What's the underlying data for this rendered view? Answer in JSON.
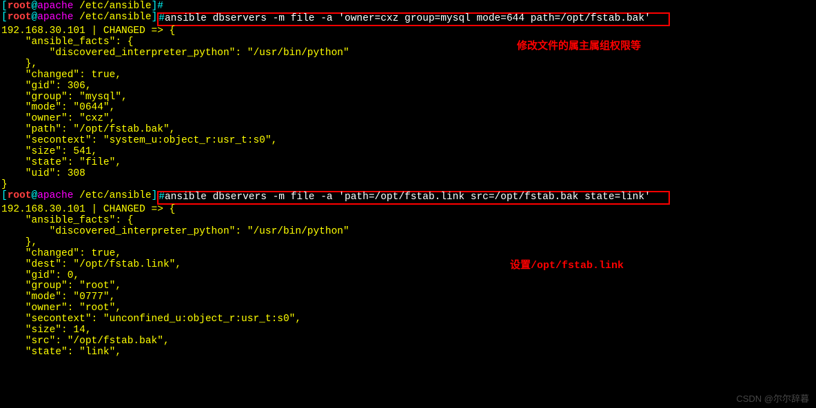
{
  "prompt": {
    "user": "root",
    "host": "apache",
    "path": "/etc/ansible"
  },
  "cmd1": {
    "text": "ansible dbservers -m file -a 'owner=cxz group=mysql mode=644 path=/opt/fstab.bak'"
  },
  "note1": "修改文件的属主属组权限等",
  "out1": {
    "header": "192.168.30.101 | CHANGED => {",
    "facts_open": "    \"ansible_facts\": {",
    "disc": "        \"discovered_interpreter_python\": \"/usr/bin/python\"",
    "facts_close": "    },",
    "changed": "    \"changed\": true,",
    "gid": "    \"gid\": 306,",
    "group": "    \"group\": \"mysql\",",
    "mode": "    \"mode\": \"0644\",",
    "owner": "    \"owner\": \"cxz\",",
    "path": "    \"path\": \"/opt/fstab.bak\",",
    "secontext": "    \"secontext\": \"system_u:object_r:usr_t:s0\",",
    "size": "    \"size\": 541,",
    "state": "    \"state\": \"file\",",
    "uid": "    \"uid\": 308",
    "close": "}"
  },
  "cmd2": {
    "text": "ansible dbservers -m file -a 'path=/opt/fstab.link src=/opt/fstab.bak state=link'"
  },
  "note2": "设置/opt/fstab.link",
  "out2": {
    "header": "192.168.30.101 | CHANGED => {",
    "facts_open": "    \"ansible_facts\": {",
    "disc": "        \"discovered_interpreter_python\": \"/usr/bin/python\"",
    "facts_close": "    },",
    "changed": "    \"changed\": true,",
    "dest": "    \"dest\": \"/opt/fstab.link\",",
    "gid": "    \"gid\": 0,",
    "group": "    \"group\": \"root\",",
    "mode": "    \"mode\": \"0777\",",
    "owner": "    \"owner\": \"root\",",
    "secontext": "    \"secontext\": \"unconfined_u:object_r:usr_t:s0\",",
    "size": "    \"size\": 14,",
    "src": "    \"src\": \"/opt/fstab.bak\",",
    "state": "    \"state\": \"link\","
  },
  "watermark": "CSDN @尔尔辞暮"
}
